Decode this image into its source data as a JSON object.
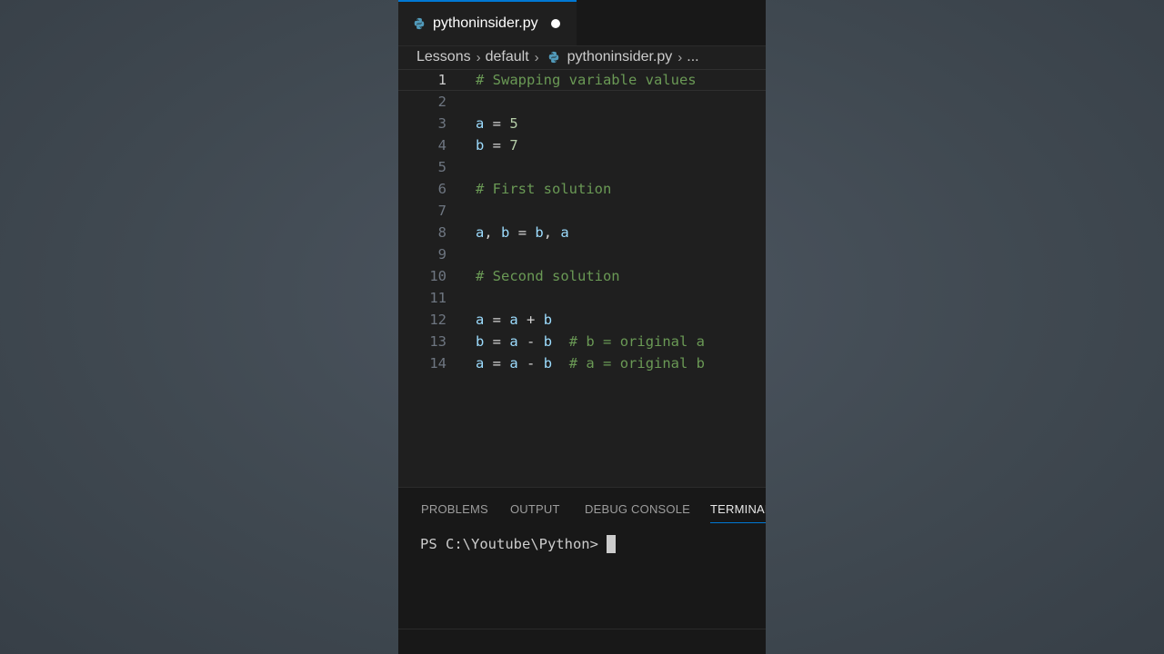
{
  "tab": {
    "label": "pythoninsider.py",
    "modified": true
  },
  "breadcrumb": [
    "Lessons",
    "default",
    "pythoninsider.py",
    "..."
  ],
  "code": {
    "active_line": 1,
    "lines": [
      {
        "n": "1",
        "tokens": [
          {
            "t": "# Swapping variable values",
            "k": "c"
          }
        ]
      },
      {
        "n": "2",
        "tokens": []
      },
      {
        "n": "3",
        "tokens": [
          {
            "t": "a",
            "k": "v"
          },
          {
            "t": " = ",
            "k": "o"
          },
          {
            "t": "5",
            "k": "n"
          }
        ]
      },
      {
        "n": "4",
        "tokens": [
          {
            "t": "b",
            "k": "v"
          },
          {
            "t": " = ",
            "k": "o"
          },
          {
            "t": "7",
            "k": "n"
          }
        ]
      },
      {
        "n": "5",
        "tokens": []
      },
      {
        "n": "6",
        "tokens": [
          {
            "t": "# First solution",
            "k": "c"
          }
        ]
      },
      {
        "n": "7",
        "tokens": []
      },
      {
        "n": "8",
        "tokens": [
          {
            "t": "a",
            "k": "v"
          },
          {
            "t": ", ",
            "k": "o"
          },
          {
            "t": "b",
            "k": "v"
          },
          {
            "t": " = ",
            "k": "o"
          },
          {
            "t": "b",
            "k": "v"
          },
          {
            "t": ", ",
            "k": "o"
          },
          {
            "t": "a",
            "k": "v"
          }
        ]
      },
      {
        "n": "9",
        "tokens": []
      },
      {
        "n": "10",
        "tokens": [
          {
            "t": "# Second solution",
            "k": "c"
          }
        ]
      },
      {
        "n": "11",
        "tokens": []
      },
      {
        "n": "12",
        "tokens": [
          {
            "t": "a",
            "k": "v"
          },
          {
            "t": " = ",
            "k": "o"
          },
          {
            "t": "a",
            "k": "v"
          },
          {
            "t": " + ",
            "k": "o"
          },
          {
            "t": "b",
            "k": "v"
          }
        ]
      },
      {
        "n": "13",
        "tokens": [
          {
            "t": "b",
            "k": "v"
          },
          {
            "t": " = ",
            "k": "o"
          },
          {
            "t": "a",
            "k": "v"
          },
          {
            "t": " - ",
            "k": "o"
          },
          {
            "t": "b",
            "k": "v"
          },
          {
            "t": "  ",
            "k": "o"
          },
          {
            "t": "# b = original a",
            "k": "c"
          }
        ]
      },
      {
        "n": "14",
        "tokens": [
          {
            "t": "a",
            "k": "v"
          },
          {
            "t": " = ",
            "k": "o"
          },
          {
            "t": "a",
            "k": "v"
          },
          {
            "t": " - ",
            "k": "o"
          },
          {
            "t": "b",
            "k": "v"
          },
          {
            "t": "  ",
            "k": "o"
          },
          {
            "t": "# a = original b",
            "k": "c"
          }
        ]
      }
    ]
  },
  "panel": {
    "tabs": [
      "PROBLEMS",
      "OUTPUT",
      "DEBUG CONSOLE",
      "TERMINAL"
    ],
    "active_tab": "TERMINAL",
    "terminal_prompt": "PS C:\\Youtube\\Python>"
  },
  "icons": {
    "file_icon": "python-icon",
    "separator": "chevron-right-icon"
  },
  "colors": {
    "accent": "#0078d4",
    "editor_bg": "#1f1f1f",
    "variable": "#9cdcfe",
    "number": "#b5cea8",
    "comment": "#6a9955"
  }
}
